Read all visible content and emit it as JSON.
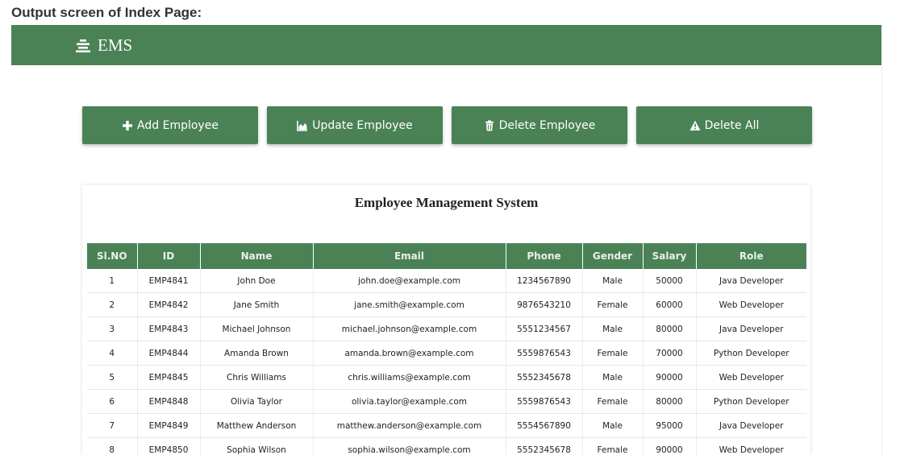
{
  "caption": "Output screen of Index Page:",
  "navbar": {
    "brand": "EMS",
    "brand_icon": "menu-bars-icon",
    "color": "#4a8256"
  },
  "actions": [
    {
      "label": "Add Employee",
      "icon": "plus-icon"
    },
    {
      "label": "Update Employee",
      "icon": "area-chart-icon"
    },
    {
      "label": "Delete Employee",
      "icon": "trash-icon"
    },
    {
      "label": "Delete All",
      "icon": "warning-icon"
    }
  ],
  "table": {
    "title": "Employee Management System",
    "columns": [
      "Sl.NO",
      "ID",
      "Name",
      "Email",
      "Phone",
      "Gender",
      "Salary",
      "Role"
    ],
    "rows": [
      [
        "1",
        "EMP4841",
        "John Doe",
        "john.doe@example.com",
        "1234567890",
        "Male",
        "50000",
        "Java Developer"
      ],
      [
        "2",
        "EMP4842",
        "Jane Smith",
        "jane.smith@example.com",
        "9876543210",
        "Female",
        "60000",
        "Web Developer"
      ],
      [
        "3",
        "EMP4843",
        "Michael Johnson",
        "michael.johnson@example.com",
        "5551234567",
        "Male",
        "80000",
        "Java Developer"
      ],
      [
        "4",
        "EMP4844",
        "Amanda Brown",
        "amanda.brown@example.com",
        "5559876543",
        "Female",
        "70000",
        "Python Developer"
      ],
      [
        "5",
        "EMP4845",
        "Chris Williams",
        "chris.williams@example.com",
        "5552345678",
        "Male",
        "90000",
        "Web Developer"
      ],
      [
        "6",
        "EMP4848",
        "Olivia Taylor",
        "olivia.taylor@example.com",
        "5559876543",
        "Female",
        "80000",
        "Python Developer"
      ],
      [
        "7",
        "EMP4849",
        "Matthew Anderson",
        "matthew.anderson@example.com",
        "5554567890",
        "Male",
        "95000",
        "Java Developer"
      ],
      [
        "8",
        "EMP4850",
        "Sophia Wilson",
        "sophia.wilson@example.com",
        "5552345678",
        "Female",
        "90000",
        "Web Developer"
      ]
    ]
  }
}
